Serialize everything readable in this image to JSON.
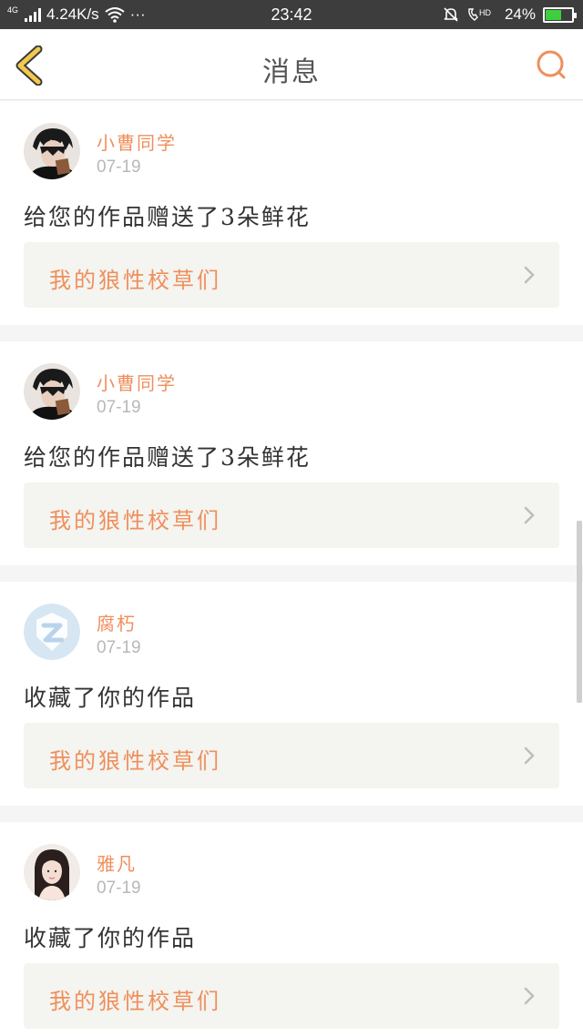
{
  "status_bar": {
    "network": "4G",
    "speed": "4.24K/s",
    "more": "···",
    "time": "23:42",
    "hd": "HD",
    "battery": "24%"
  },
  "header": {
    "title": "消息",
    "back_icon": "chevron-left-icon",
    "search_icon": "search-icon"
  },
  "colors": {
    "accent": "#ef8f5c",
    "back_icon": "#f2c94c"
  },
  "messages": [
    {
      "user": "小曹同学",
      "date": "07-19",
      "action": "给您的作品赠送了3朵鲜花",
      "work": "我的狼性校草们",
      "avatar": "dark-haired-boy"
    },
    {
      "user": "小曹同学",
      "date": "07-19",
      "action": "给您的作品赠送了3朵鲜花",
      "work": "我的狼性校草们",
      "avatar": "dark-haired-boy"
    },
    {
      "user": "腐朽",
      "date": "07-19",
      "action": "收藏了你的作品",
      "work": "我的狼性校草们",
      "avatar": "default-z-logo"
    },
    {
      "user": "雅凡",
      "date": "07-19",
      "action": "收藏了你的作品",
      "work": "我的狼性校草们",
      "avatar": "girl-portrait"
    }
  ]
}
